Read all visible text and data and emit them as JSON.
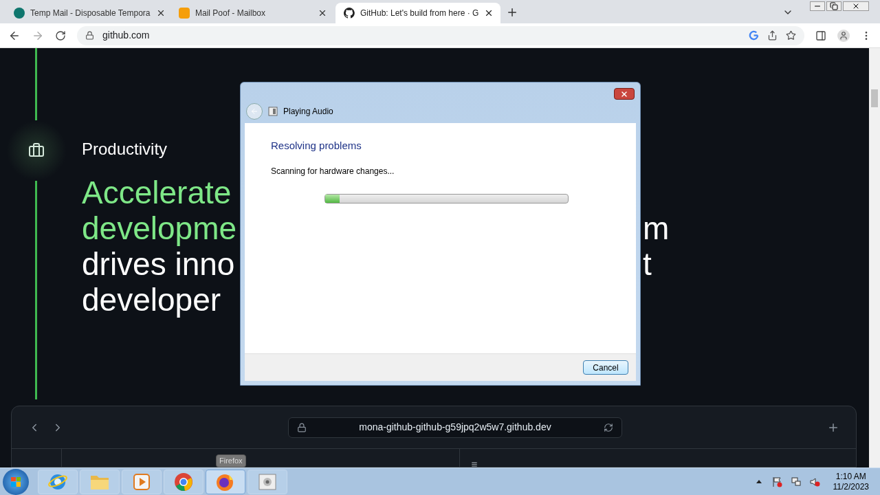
{
  "browser": {
    "tabs": [
      {
        "title": "Temp Mail - Disposable Tempora",
        "selected": false
      },
      {
        "title": "Mail Poof - Mailbox",
        "selected": false
      },
      {
        "title": "GitHub: Let's build from here · G",
        "selected": true
      }
    ],
    "url": "github.com"
  },
  "page": {
    "section_label": "Productivity",
    "headline": [
      {
        "text": "Accelerate",
        "highlight": true
      },
      {
        "text": "developme",
        "highlight": true,
        "right": "m"
      },
      {
        "text": "drives inno",
        "highlight": false,
        "right": "t"
      },
      {
        "text": "developer",
        "highlight": false
      }
    ],
    "preview": {
      "url": "mona-github-github-g59jpq2w5w7.github.dev"
    }
  },
  "dialog": {
    "title": "Playing Audio",
    "heading": "Resolving problems",
    "status": "Scanning for hardware changes...",
    "progress": {
      "level": 0.06
    },
    "buttons": [
      "Cancel"
    ]
  },
  "taskbar": {
    "items": [
      {
        "kind": "ie",
        "active": false
      },
      {
        "kind": "folder",
        "active": false
      },
      {
        "kind": "media",
        "active": false
      },
      {
        "kind": "chrome",
        "active": false
      },
      {
        "kind": "firefox",
        "active": true
      },
      {
        "kind": "audio",
        "active": false
      }
    ],
    "tooltip": "Firefox",
    "time": "1:10 AM",
    "date": "11/2/2023"
  }
}
